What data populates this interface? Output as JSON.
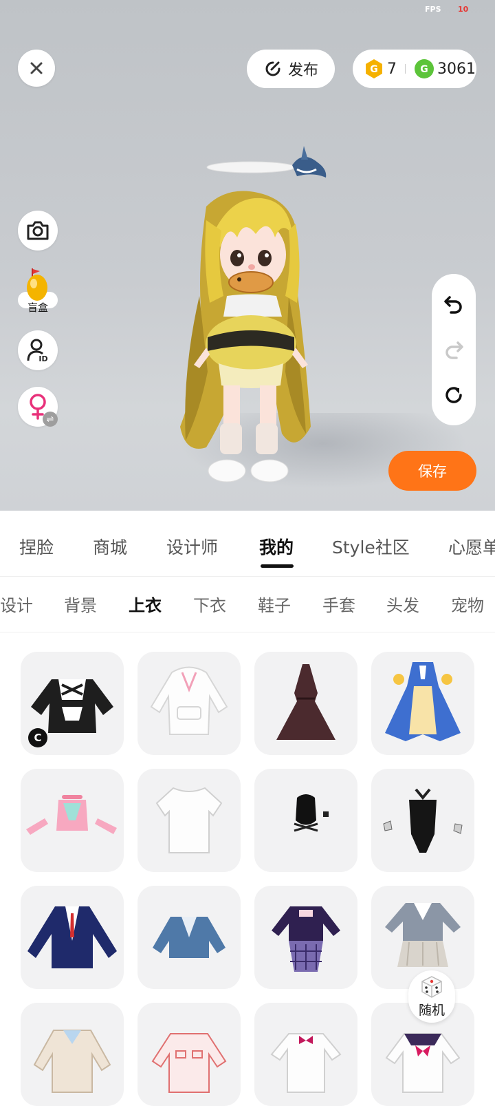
{
  "fps": {
    "label": "FPS",
    "value": "10"
  },
  "top_bar": {
    "publish_label": "发布",
    "currency_gold": "7",
    "currency_green": "3061"
  },
  "left_tools": {
    "blind_box_label": "盲盒"
  },
  "save_label": "保存",
  "main_tabs": [
    "捏脸",
    "商城",
    "设计师",
    "我的",
    "Style社区",
    "心愿单"
  ],
  "active_main_tab": "我的",
  "sub_tabs": [
    "设计",
    "背景",
    "上衣",
    "下衣",
    "鞋子",
    "手套",
    "头发",
    "宠物"
  ],
  "active_sub_tab": "上衣",
  "items": [
    {
      "name": "maid-jacket",
      "badge": "C"
    },
    {
      "name": "white-hoodie"
    },
    {
      "name": "brown-halter-dress"
    },
    {
      "name": "blue-idol-dress"
    },
    {
      "name": "pink-crop-top"
    },
    {
      "name": "white-tshirt"
    },
    {
      "name": "black-top-piece"
    },
    {
      "name": "black-bodysuit"
    },
    {
      "name": "navy-blazer"
    },
    {
      "name": "denim-jacket"
    },
    {
      "name": "purple-plaid-dress"
    },
    {
      "name": "grey-school-uniform"
    },
    {
      "name": "beige-cardigan"
    },
    {
      "name": "red-white-shirt"
    },
    {
      "name": "white-bow-shirt"
    },
    {
      "name": "sailor-shirt"
    }
  ],
  "random_label": "随机",
  "colors": {
    "accent": "#ff7417",
    "gold": "#f5b100",
    "green": "#5cc43a",
    "female": "#e8317a"
  }
}
